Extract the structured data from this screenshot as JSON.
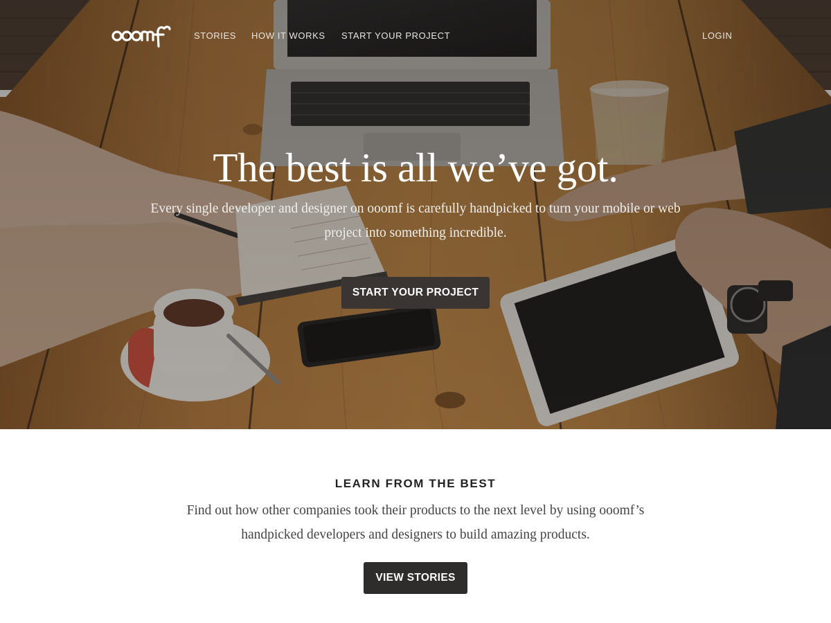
{
  "brand": {
    "logo_text": "ooomf"
  },
  "nav": {
    "stories": "STORIES",
    "how_it_works": "HOW IT WORKS",
    "start_project": "START YOUR PROJECT",
    "login": "LOGIN"
  },
  "hero": {
    "title": "The best is all we’ve got.",
    "subtitle": "Every single developer and designer on ooomf is carefully handpicked to turn your mobile or web project into something incredible.",
    "cta_label": "START YOUR PROJECT"
  },
  "stories_section": {
    "title": "LEARN FROM THE BEST",
    "description": "Find out how other companies took their products to the next level by using ooomf’s handpicked developers and designers to build amazing products.",
    "cta_label": "VIEW STORIES"
  },
  "colors": {
    "button_bg": "#2f2d2c",
    "hero_overlay": "#2a2420",
    "wood": "#b57a3c",
    "section_bg": "#ffffff"
  },
  "icons": {
    "logo": "ooomf-logo"
  }
}
